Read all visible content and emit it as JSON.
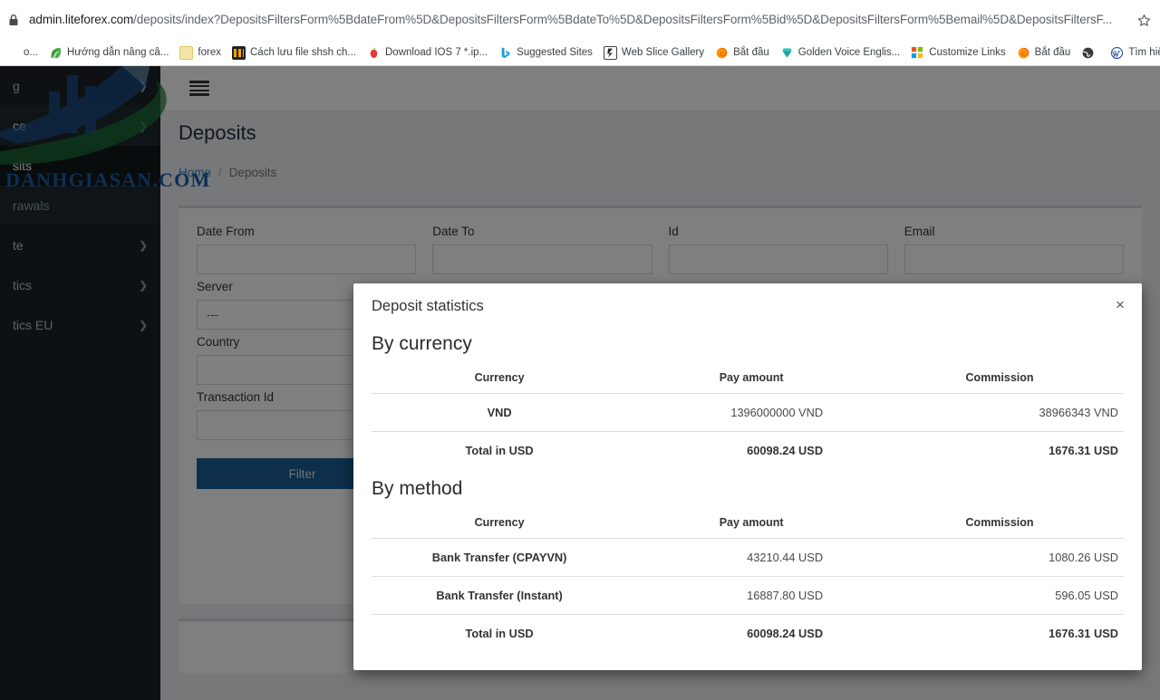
{
  "browser": {
    "lock_icon": "lock-icon",
    "url_host": "admin.liteforex.com",
    "url_path": "/deposits/index?DepositsFiltersForm%5BdateFrom%5D&DepositsFiltersForm%5BdateTo%5D&DepositsFiltersForm%5Bid%5D&DepositsFiltersForm%5Bemail%5D&DepositsFiltersF...",
    "star_icon": "bookmark-star-icon",
    "bookmarks": [
      {
        "label": "o...",
        "icon": "generic-icon"
      },
      {
        "label": "Hướng dẫn nâng câ...",
        "icon": "leaf-icon"
      },
      {
        "label": "forex",
        "icon": "folder-icon"
      },
      {
        "label": "Cách lưu file shsh ch...",
        "icon": "chart-icon"
      },
      {
        "label": "Download IOS 7 *.ip...",
        "icon": "apple-icon"
      },
      {
        "label": "Suggested Sites",
        "icon": "bing-icon"
      },
      {
        "label": "Web Slice Gallery",
        "icon": "webslice-icon"
      },
      {
        "label": "Bắt đầu",
        "icon": "firefox-icon"
      },
      {
        "label": "Golden Voice Englis...",
        "icon": "diamond-icon"
      },
      {
        "label": "Customize Links",
        "icon": "microsoft-icon"
      },
      {
        "label": "Bắt đầu",
        "icon": "firefox-icon"
      },
      {
        "label": "",
        "icon": "globe-icon"
      },
      {
        "label": "Tìm hiểu sự k",
        "icon": "wordpress-icon"
      }
    ]
  },
  "watermark": {
    "text": "DANHGIASAN.COM",
    "logo_icon": "bull-chart-logo-icon",
    "color": "#1b5ea8"
  },
  "sidebar": {
    "items": [
      {
        "label": "g",
        "type": "parent",
        "caret": "chevron-right-icon",
        "name": "sidebar-item-trading"
      },
      {
        "label": "ce",
        "type": "parent-open",
        "caret": "chevron-down-icon",
        "name": "sidebar-item-finance"
      },
      {
        "label": "sits",
        "type": "child-active",
        "name": "sidebar-item-deposits"
      },
      {
        "label": "rawals",
        "type": "child",
        "name": "sidebar-item-withdrawals"
      },
      {
        "label": "te",
        "type": "parent",
        "caret": "chevron-right-icon",
        "name": "sidebar-item-site"
      },
      {
        "label": "tics",
        "type": "parent",
        "caret": "chevron-right-icon",
        "name": "sidebar-item-statistics"
      },
      {
        "label": "tics EU",
        "type": "parent",
        "caret": "chevron-right-icon",
        "name": "sidebar-item-statistics-eu"
      }
    ]
  },
  "navbar": {
    "menu_toggle_icon": "hamburger-icon"
  },
  "page": {
    "title": "Deposits",
    "breadcrumb": {
      "home": "Home",
      "separator": "/",
      "current": "Deposits"
    }
  },
  "filters": {
    "date_from_label": "Date From",
    "date_from_value": "",
    "date_to_label": "Date To",
    "date_to_value": "",
    "id_label": "Id",
    "id_value": "",
    "email_label": "Email",
    "email_value": "",
    "server_label": "Server",
    "server_value": "---",
    "country_label": "Country",
    "country_value": "",
    "transaction_id_label": "Transaction Id",
    "transaction_id_value": "",
    "filter_button": "Filter"
  },
  "modal": {
    "title": "Deposit statistics",
    "close_icon": "close-icon",
    "sections": [
      {
        "heading": "By currency",
        "columns": [
          "Currency",
          "Pay amount",
          "Commission"
        ],
        "rows": [
          [
            "VND",
            "1396000000 VND",
            "38966343 VND"
          ]
        ],
        "total": [
          "Total in USD",
          "60098.24 USD",
          "1676.31 USD"
        ]
      },
      {
        "heading": "By method",
        "columns": [
          "Currency",
          "Pay amount",
          "Commission"
        ],
        "rows": [
          [
            "Bank Transfer (CPAYVN)",
            "43210.44 USD",
            "1080.26 USD"
          ],
          [
            "Bank Transfer (Instant)",
            "16887.80 USD",
            "596.05 USD"
          ]
        ],
        "total": [
          "Total in USD",
          "60098.24 USD",
          "1676.31 USD"
        ]
      }
    ]
  },
  "colors": {
    "accent": "#1a5f96",
    "sidebar_bg": "#1a2226",
    "page_bg": "#ecf0f5",
    "link": "#3c8dbc"
  }
}
